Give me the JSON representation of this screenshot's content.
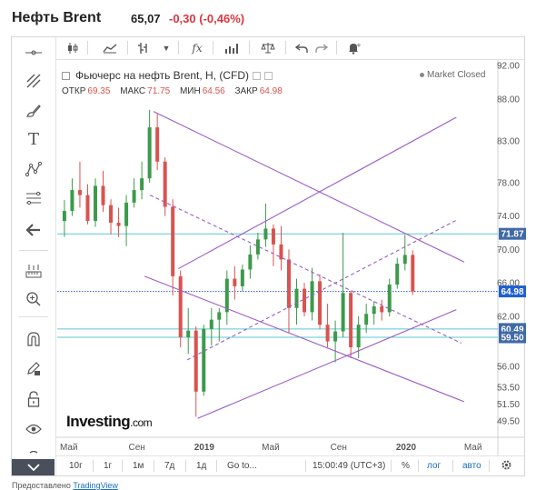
{
  "header": {
    "title": "Нефть Brent",
    "price": "65,07",
    "change": "-0,30 (-0,46%)",
    "change_color": "#d9363e"
  },
  "legend": {
    "name": "Фьючерс на нефть Brent, H, (CFD)",
    "open_label": "ОТКР",
    "open": "69.35",
    "high_label": "МАКС",
    "high": "71.75",
    "low_label": "МИН",
    "low": "64.56",
    "close_label": "ЗАКР",
    "close": "64.98",
    "status": "Market Closed"
  },
  "watermark": {
    "brand": "Investing",
    "domain": ".com"
  },
  "toolbar": {
    "icons": [
      "candles-icon",
      "line-chart-icon",
      "bar-chart-icon",
      "dropdown-arrow-icon",
      "indicator-fx-icon",
      "histogram-icon",
      "balance-icon",
      "undo-icon",
      "redo-icon",
      "alert-bell-icon"
    ]
  },
  "sidebar": {
    "icons": [
      "crosshair-icon",
      "trend-line-icon",
      "brush-icon",
      "text-icon",
      "pattern-icon",
      "fib-icon",
      "arrow-left-icon",
      "measure-icon",
      "zoom-icon",
      "magnet-icon",
      "lock-pencil-icon",
      "lock-icon",
      "eye-icon",
      "trash-icon"
    ],
    "collapse_icon": "chevron-down-icon"
  },
  "bottom_bar": {
    "ranges": [
      "10г",
      "1г",
      "1м",
      "7д",
      "1д",
      "Go to..."
    ],
    "time": "15:00:49 (UTC+3)",
    "percent": "%",
    "log": "лог",
    "auto": "авто",
    "settings_icon": "gear-icon"
  },
  "credit": {
    "prefix": "Предоставлено",
    "link": "TradingView"
  },
  "chart_data": {
    "type": "candlestick",
    "time_axis": {
      "start": "2018-05",
      "end": "2020-06",
      "tick_labels": [
        "Май",
        "Сен",
        "2019",
        "Май",
        "Сен",
        "2020",
        "Май"
      ]
    },
    "y_axis": {
      "min": 48.0,
      "max": 92.0,
      "tick_labels": [
        "92.00",
        "88.00",
        "83.00",
        "78.00",
        "74.00",
        "70.00",
        "66.00",
        "62.00",
        "60.49",
        "59.50",
        "56.00",
        "53.50",
        "51.50",
        "49.50"
      ]
    },
    "price_labels": [
      {
        "value": 71.87,
        "label": "71.87",
        "color": "#3f6aa6"
      },
      {
        "value": 64.98,
        "label": "64.98",
        "color": "#1f5fd1"
      },
      {
        "value": 60.49,
        "label": "60.49",
        "color": "#3f6aa6"
      },
      {
        "value": 59.5,
        "label": "59.50",
        "color": "#3f6aa6"
      }
    ],
    "horizontal_lines": [
      {
        "value": 71.87,
        "style": "solid",
        "color": "#5bc8d6"
      },
      {
        "value": 64.98,
        "style": "dotted",
        "color": "#1f5fd1"
      },
      {
        "value": 60.49,
        "style": "solid",
        "color": "#5bc8d6"
      },
      {
        "value": 59.5,
        "style": "solid",
        "color": "#5bc8d6"
      }
    ],
    "channel_lines": [
      {
        "from": [
          "2018-10-01",
          86.5
        ],
        "to": [
          "2020-04-15",
          68.5
        ],
        "style": "solid"
      },
      {
        "from": [
          "2018-09-15",
          66.8
        ],
        "to": [
          "2020-04-15",
          51.8
        ],
        "style": "solid"
      },
      {
        "from": [
          "2018-12-20",
          49.8
        ],
        "to": [
          "2020-04-01",
          62.8
        ],
        "style": "solid"
      },
      {
        "from": [
          "2018-11-15",
          67.7
        ],
        "to": [
          "2020-04-01",
          85.8
        ],
        "style": "solid"
      },
      {
        "from": [
          "2018-09-25",
          76.5
        ],
        "to": [
          "2020-04-10",
          58.8
        ],
        "style": "dashed"
      },
      {
        "from": [
          "2018-12-01",
          56.8
        ],
        "to": [
          "2020-04-01",
          73.5
        ],
        "style": "dashed"
      }
    ],
    "up_color": "#3c9a4a",
    "down_color": "#d9534f",
    "line_color": "#9c5bc4",
    "candles": [
      {
        "date": "2018-04-23",
        "open": 73.4,
        "high": 75.9,
        "low": 71.5,
        "close": 74.6
      },
      {
        "date": "2018-05-07",
        "open": 74.6,
        "high": 78.5,
        "low": 74.0,
        "close": 77.1
      },
      {
        "date": "2018-05-21",
        "open": 77.1,
        "high": 80.5,
        "low": 75.0,
        "close": 76.5
      },
      {
        "date": "2018-06-04",
        "open": 76.5,
        "high": 77.8,
        "low": 73.0,
        "close": 73.4
      },
      {
        "date": "2018-06-18",
        "open": 73.4,
        "high": 78.5,
        "low": 72.7,
        "close": 77.6
      },
      {
        "date": "2018-07-02",
        "open": 77.6,
        "high": 79.4,
        "low": 74.5,
        "close": 75.3
      },
      {
        "date": "2018-07-16",
        "open": 75.3,
        "high": 76.0,
        "low": 71.8,
        "close": 73.2
      },
      {
        "date": "2018-07-30",
        "open": 73.2,
        "high": 75.0,
        "low": 71.5,
        "close": 72.8
      },
      {
        "date": "2018-08-13",
        "open": 72.8,
        "high": 76.5,
        "low": 70.4,
        "close": 75.6
      },
      {
        "date": "2018-08-27",
        "open": 75.6,
        "high": 78.5,
        "low": 75.0,
        "close": 77.1
      },
      {
        "date": "2018-09-10",
        "open": 77.1,
        "high": 80.5,
        "low": 76.0,
        "close": 78.5
      },
      {
        "date": "2018-09-24",
        "open": 78.5,
        "high": 86.7,
        "low": 78.0,
        "close": 84.6
      },
      {
        "date": "2018-10-08",
        "open": 84.6,
        "high": 86.2,
        "low": 79.5,
        "close": 80.5
      },
      {
        "date": "2018-10-22",
        "open": 80.5,
        "high": 81.0,
        "low": 74.0,
        "close": 75.1
      },
      {
        "date": "2018-11-05",
        "open": 75.1,
        "high": 76.0,
        "low": 64.5,
        "close": 66.8
      },
      {
        "date": "2018-11-19",
        "open": 66.8,
        "high": 67.5,
        "low": 58.3,
        "close": 59.5
      },
      {
        "date": "2018-12-03",
        "open": 59.5,
        "high": 63.0,
        "low": 57.5,
        "close": 60.3
      },
      {
        "date": "2018-12-17",
        "open": 60.3,
        "high": 60.8,
        "low": 50.0,
        "close": 53.0
      },
      {
        "date": "2018-12-31",
        "open": 53.0,
        "high": 61.0,
        "low": 52.5,
        "close": 60.5
      },
      {
        "date": "2019-01-14",
        "open": 60.5,
        "high": 63.0,
        "low": 58.5,
        "close": 61.6
      },
      {
        "date": "2019-01-28",
        "open": 61.6,
        "high": 63.0,
        "low": 59.0,
        "close": 62.5
      },
      {
        "date": "2019-02-11",
        "open": 62.5,
        "high": 67.5,
        "low": 61.0,
        "close": 66.5
      },
      {
        "date": "2019-02-25",
        "open": 66.5,
        "high": 68.0,
        "low": 64.0,
        "close": 65.6
      },
      {
        "date": "2019-03-11",
        "open": 65.6,
        "high": 68.2,
        "low": 65.0,
        "close": 67.6
      },
      {
        "date": "2019-03-25",
        "open": 67.6,
        "high": 70.5,
        "low": 66.5,
        "close": 69.4
      },
      {
        "date": "2019-04-08",
        "open": 69.4,
        "high": 72.0,
        "low": 68.8,
        "close": 71.2
      },
      {
        "date": "2019-04-22",
        "open": 71.2,
        "high": 75.5,
        "low": 70.3,
        "close": 72.5
      },
      {
        "date": "2019-05-06",
        "open": 72.5,
        "high": 73.0,
        "low": 68.0,
        "close": 70.6
      },
      {
        "date": "2019-05-20",
        "open": 70.6,
        "high": 72.8,
        "low": 67.5,
        "close": 68.8
      },
      {
        "date": "2019-06-03",
        "open": 68.8,
        "high": 70.0,
        "low": 60.0,
        "close": 63.0
      },
      {
        "date": "2019-06-17",
        "open": 63.0,
        "high": 66.5,
        "low": 61.0,
        "close": 65.3
      },
      {
        "date": "2019-07-01",
        "open": 65.3,
        "high": 66.0,
        "low": 62.0,
        "close": 62.5
      },
      {
        "date": "2019-07-15",
        "open": 62.5,
        "high": 67.8,
        "low": 61.5,
        "close": 66.2
      },
      {
        "date": "2019-07-29",
        "open": 66.2,
        "high": 67.0,
        "low": 60.5,
        "close": 61.0
      },
      {
        "date": "2019-08-12",
        "open": 61.0,
        "high": 63.5,
        "low": 58.3,
        "close": 59.0
      },
      {
        "date": "2019-08-26",
        "open": 59.0,
        "high": 61.5,
        "low": 56.5,
        "close": 60.2
      },
      {
        "date": "2019-09-09",
        "open": 60.2,
        "high": 72.0,
        "low": 59.5,
        "close": 64.8
      },
      {
        "date": "2019-09-23",
        "open": 64.8,
        "high": 65.0,
        "low": 57.0,
        "close": 58.3
      },
      {
        "date": "2019-10-07",
        "open": 58.3,
        "high": 62.0,
        "low": 57.0,
        "close": 61.0
      },
      {
        "date": "2019-10-21",
        "open": 61.0,
        "high": 63.5,
        "low": 60.0,
        "close": 62.3
      },
      {
        "date": "2019-11-04",
        "open": 62.3,
        "high": 63.8,
        "low": 61.0,
        "close": 63.2
      },
      {
        "date": "2019-11-18",
        "open": 63.2,
        "high": 64.0,
        "low": 61.5,
        "close": 62.5
      },
      {
        "date": "2019-12-02",
        "open": 62.5,
        "high": 66.5,
        "low": 62.0,
        "close": 65.8
      },
      {
        "date": "2019-12-16",
        "open": 65.8,
        "high": 69.0,
        "low": 65.3,
        "close": 68.3
      },
      {
        "date": "2019-12-30",
        "open": 68.3,
        "high": 71.75,
        "low": 67.5,
        "close": 69.35
      },
      {
        "date": "2020-01-13",
        "open": 69.35,
        "high": 69.9,
        "low": 64.56,
        "close": 64.98
      }
    ]
  }
}
